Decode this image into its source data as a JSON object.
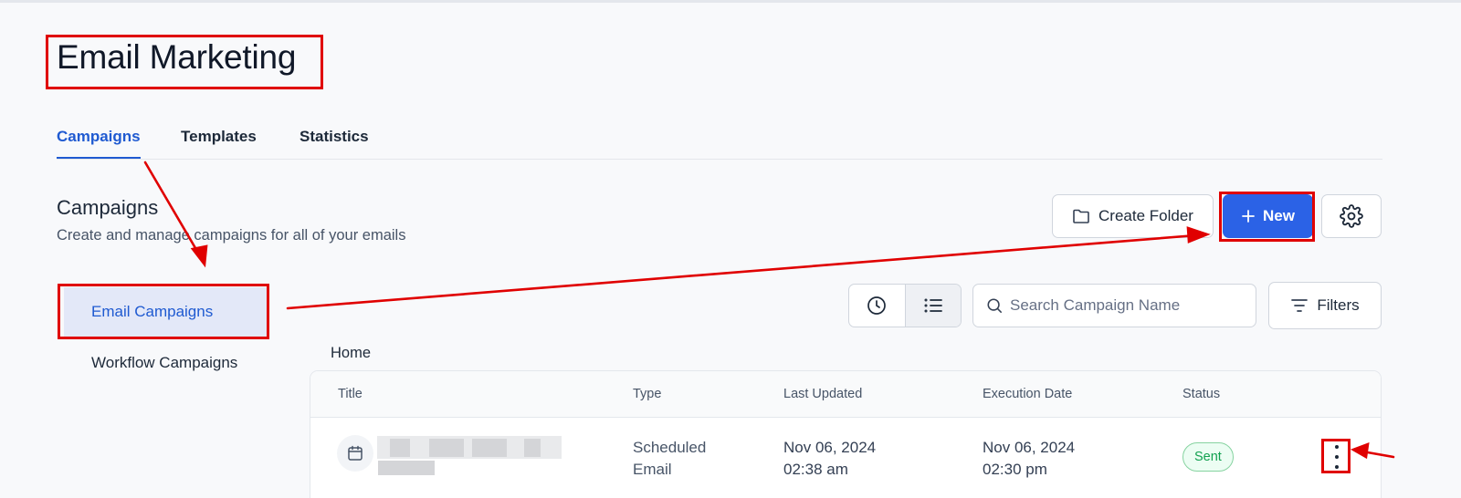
{
  "page": {
    "title": "Email Marketing"
  },
  "tabs": [
    {
      "label": "Campaigns",
      "active": true
    },
    {
      "label": "Templates",
      "active": false
    },
    {
      "label": "Statistics",
      "active": false
    }
  ],
  "section": {
    "title": "Campaigns",
    "subtitle": "Create and manage campaigns for all of your emails"
  },
  "toolbar": {
    "create_folder_label": "Create Folder",
    "new_label": "New",
    "filters_label": "Filters"
  },
  "sidebar": {
    "items": [
      {
        "label": "Email Campaigns",
        "active": true
      },
      {
        "label": "Workflow Campaigns",
        "active": false
      }
    ]
  },
  "search": {
    "placeholder": "Search Campaign Name",
    "value": ""
  },
  "breadcrumb": {
    "home": "Home"
  },
  "table": {
    "columns": [
      "Title",
      "Type",
      "Last Updated",
      "Execution Date",
      "Status"
    ],
    "rows": [
      {
        "type_line1": "Scheduled",
        "type_line2": "Email",
        "last_updated_date": "Nov 06, 2024",
        "last_updated_time": "02:38 am",
        "execution_date": "Nov 06, 2024",
        "execution_time": "02:30 pm",
        "status": "Sent"
      }
    ]
  },
  "colors": {
    "accent": "#1f5ad1",
    "primary_button": "#2b62e6",
    "status_sent": "#12a150",
    "annotation": "#e00000"
  },
  "icons": [
    "folder-icon",
    "plus-icon",
    "gear-icon",
    "clock-icon",
    "list-icon",
    "search-icon",
    "filter-icon",
    "calendar-icon",
    "kebab-icon"
  ]
}
